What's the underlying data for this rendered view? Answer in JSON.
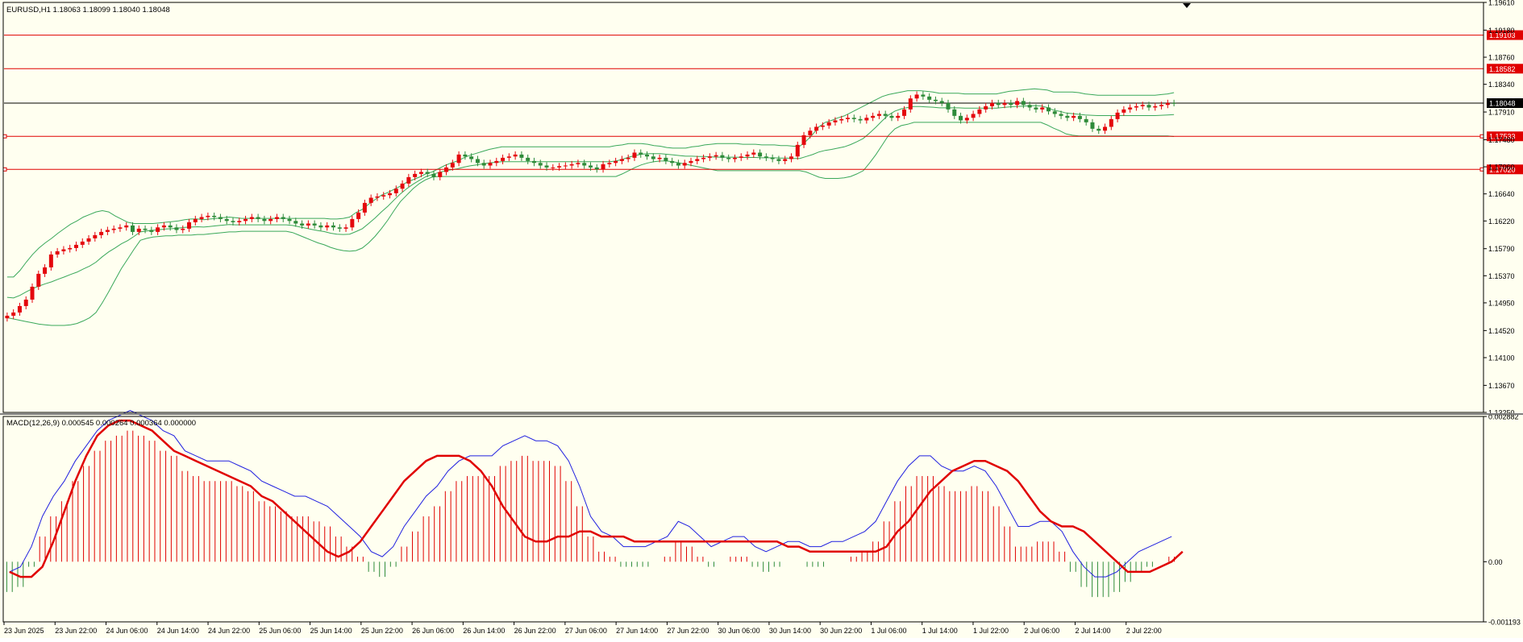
{
  "window": {
    "symbol_header": "EURUSD,H1  1.18063 1.18099 1.18040 1.18048",
    "macd_header": "MACD(12,26,9) 0.000545 0.000264 0.000364 0.000000"
  },
  "colors": {
    "background": "#fffff0",
    "frame": "#000000",
    "bull_candle": "#e4070d",
    "bear_candle": "#2e8b3a",
    "bands": "#3aa85a",
    "level_line": "#e00000",
    "price_line": "#000000",
    "macd_line": "#2020e0",
    "signal_line": "#e00000",
    "hist_positive": "#e00000",
    "hist_negative": "#2e8b3a"
  },
  "chart_data": [
    {
      "type": "candlestick",
      "symbol": "EURUSD",
      "timeframe": "H1",
      "ohlc_header": {
        "open": 1.18063,
        "high": 1.18099,
        "low": 1.1804,
        "close": 1.18048
      },
      "ylim": [
        1.1325,
        1.1961
      ],
      "y_ticks": [
        "1.19610",
        "1.19180",
        "1.18760",
        "1.18340",
        "1.17910",
        "1.17480",
        "1.17060",
        "1.16640",
        "1.16220",
        "1.15790",
        "1.15370",
        "1.14950",
        "1.14520",
        "1.14100",
        "1.13670",
        "1.13250"
      ],
      "x_ticks": [
        "23 Jun 2025",
        "23 Jun 22:00",
        "24 Jun 06:00",
        "24 Jun 14:00",
        "24 Jun 22:00",
        "25 Jun 06:00",
        "25 Jun 14:00",
        "25 Jun 22:00",
        "26 Jun 06:00",
        "26 Jun 14:00",
        "26 Jun 22:00",
        "27 Jun 06:00",
        "27 Jun 14:00",
        "27 Jun 22:00",
        "30 Jun 06:00",
        "30 Jun 14:00",
        "30 Jun 22:00",
        "1 Jul 06:00",
        "1 Jul 14:00",
        "1 Jul 22:00",
        "2 Jul 06:00",
        "2 Jul 14:00",
        "2 Jul 22:00"
      ],
      "horizontal_levels": [
        {
          "label": "1.19103",
          "value": 1.19103,
          "kind": "resistance"
        },
        {
          "label": "1.18582",
          "value": 1.18582,
          "kind": "resistance"
        },
        {
          "label": "1.18048",
          "value": 1.18048,
          "kind": "current_price"
        },
        {
          "label": "1.17533",
          "value": 1.17533,
          "kind": "support"
        },
        {
          "label": "1.17020",
          "value": 1.1702,
          "kind": "support"
        }
      ],
      "close_path": [
        1.1475,
        1.148,
        1.149,
        1.15,
        1.152,
        1.154,
        1.155,
        1.157,
        1.1575,
        1.1578,
        1.158,
        1.1585,
        1.159,
        1.1595,
        1.16,
        1.1605,
        1.1608,
        1.161,
        1.1612,
        1.1615,
        1.1605,
        1.161,
        1.1608,
        1.1605,
        1.1612,
        1.1615,
        1.1612,
        1.1608,
        1.161,
        1.162,
        1.1625,
        1.1628,
        1.163,
        1.1628,
        1.1625,
        1.1622,
        1.162,
        1.1622,
        1.1625,
        1.1628,
        1.1625,
        1.1622,
        1.1625,
        1.1628,
        1.1625,
        1.1622,
        1.1618,
        1.1615,
        1.1618,
        1.1615,
        1.1612,
        1.1615,
        1.1612,
        1.161,
        1.1612,
        1.1625,
        1.1635,
        1.165,
        1.1658,
        1.166,
        1.1662,
        1.1665,
        1.1672,
        1.168,
        1.169,
        1.1695,
        1.1698,
        1.1695,
        1.169,
        1.1698,
        1.1705,
        1.1712,
        1.1725,
        1.1722,
        1.1718,
        1.1712,
        1.1708,
        1.1712,
        1.1715,
        1.172,
        1.1722,
        1.1725,
        1.172,
        1.1715,
        1.1712,
        1.1708,
        1.1705,
        1.1705,
        1.1707,
        1.1708,
        1.171,
        1.1712,
        1.1708,
        1.1705,
        1.1702,
        1.171,
        1.1712,
        1.1715,
        1.1718,
        1.172,
        1.1728,
        1.1725,
        1.1722,
        1.1718,
        1.172,
        1.1715,
        1.1712,
        1.1708,
        1.1712,
        1.1715,
        1.1718,
        1.172,
        1.1722,
        1.1724,
        1.172,
        1.1718,
        1.172,
        1.1722,
        1.1725,
        1.1728,
        1.1722,
        1.172,
        1.1718,
        1.1715,
        1.1718,
        1.1722,
        1.174,
        1.1755,
        1.1762,
        1.1768,
        1.177,
        1.1775,
        1.1778,
        1.178,
        1.1782,
        1.178,
        1.1778,
        1.1782,
        1.1785,
        1.1788,
        1.1785,
        1.1782,
        1.1785,
        1.1795,
        1.1812,
        1.1818,
        1.1815,
        1.181,
        1.1808,
        1.1805,
        1.1795,
        1.1785,
        1.1778,
        1.1782,
        1.1788,
        1.1795,
        1.18,
        1.1805,
        1.1802,
        1.1805,
        1.1802,
        1.1808,
        1.1802,
        1.1798,
        1.1795,
        1.1798,
        1.1792,
        1.1788,
        1.1785,
        1.1782,
        1.1785,
        1.178,
        1.1775,
        1.1765,
        1.1762,
        1.1768,
        1.178,
        1.179,
        1.1795,
        1.1798,
        1.18,
        1.1802,
        1.1798,
        1.18,
        1.1802,
        1.1805,
        1.18048
      ],
      "band_top": [
        1.1535,
        1.1535,
        1.1545,
        1.1558,
        1.157,
        1.158,
        1.1588,
        1.1595,
        1.1603,
        1.161,
        1.1617,
        1.1622,
        1.1628,
        1.1632,
        1.1636,
        1.1638,
        1.1636,
        1.163,
        1.1625,
        1.162,
        1.1618,
        1.1618,
        1.1618,
        1.1618,
        1.1619,
        1.162,
        1.1621,
        1.1622,
        1.1624,
        1.1625,
        1.1625,
        1.1624,
        1.1625,
        1.1626,
        1.1627,
        1.1628,
        1.1627,
        1.1626,
        1.1626,
        1.1626,
        1.1626,
        1.1626,
        1.1626,
        1.1626,
        1.1626,
        1.1626,
        1.1626,
        1.1626,
        1.1626,
        1.1626,
        1.1626,
        1.1625,
        1.1625,
        1.1626,
        1.1628,
        1.1635,
        1.164,
        1.1648,
        1.1655,
        1.1662,
        1.1666,
        1.1671,
        1.1676,
        1.1682,
        1.1686,
        1.169,
        1.1695,
        1.1698,
        1.1703,
        1.1708,
        1.1712,
        1.1715,
        1.172,
        1.1724,
        1.1727,
        1.173,
        1.1733,
        1.1735,
        1.1737,
        1.1737,
        1.1737,
        1.1737,
        1.1737,
        1.1737,
        1.1737,
        1.1737,
        1.1737,
        1.1737,
        1.1737,
        1.1737,
        1.1737,
        1.1737,
        1.1737,
        1.1737,
        1.1737,
        1.1737,
        1.1739,
        1.174,
        1.1742,
        1.1742,
        1.1742,
        1.1741,
        1.1739,
        1.1738,
        1.1736,
        1.1735,
        1.1735,
        1.1735,
        1.1737,
        1.1738,
        1.174,
        1.1741,
        1.1742,
        1.1742,
        1.1742,
        1.1742,
        1.1741,
        1.1741,
        1.1741,
        1.174,
        1.174,
        1.174,
        1.1739,
        1.1739,
        1.1738,
        1.1738,
        1.1746,
        1.1756,
        1.1768,
        1.1775,
        1.1778,
        1.1782,
        1.1785,
        1.179,
        1.1795,
        1.18,
        1.1805,
        1.181,
        1.1815,
        1.1818,
        1.182,
        1.1822,
        1.1824,
        1.1824,
        1.1824,
        1.1823,
        1.1822,
        1.182,
        1.182,
        1.182,
        1.182,
        1.1819,
        1.1819,
        1.1819,
        1.1819,
        1.1819,
        1.1819,
        1.1821,
        1.1823,
        1.1824,
        1.1825,
        1.1826,
        1.1827,
        1.1826,
        1.1825,
        1.1822,
        1.1822,
        1.1822,
        1.1822,
        1.1821,
        1.1819,
        1.1818,
        1.1817,
        1.1817,
        1.1817,
        1.1817,
        1.1817,
        1.1817,
        1.1817,
        1.1817,
        1.1817,
        1.1817,
        1.1818,
        1.1819,
        1.1821
      ],
      "band_bottom": [
        1.1472,
        1.147,
        1.1468,
        1.1466,
        1.1464,
        1.1462,
        1.1461,
        1.146,
        1.146,
        1.146,
        1.1461,
        1.1463,
        1.1467,
        1.1472,
        1.148,
        1.1495,
        1.1512,
        1.153,
        1.1548,
        1.1563,
        1.1578,
        1.1592,
        1.1595,
        1.1597,
        1.1598,
        1.1599,
        1.1599,
        1.16,
        1.16,
        1.16,
        1.1601,
        1.1601,
        1.1602,
        1.1603,
        1.1604,
        1.1605,
        1.1605,
        1.1606,
        1.1606,
        1.1606,
        1.1606,
        1.1606,
        1.1606,
        1.1606,
        1.1606,
        1.1604,
        1.16,
        1.1596,
        1.1592,
        1.1588,
        1.1585,
        1.1581,
        1.1578,
        1.1576,
        1.1575,
        1.1576,
        1.158,
        1.1588,
        1.1598,
        1.161,
        1.1623,
        1.1638,
        1.1652,
        1.1662,
        1.1672,
        1.168,
        1.1686,
        1.169,
        1.1691,
        1.1691,
        1.1691,
        1.1691,
        1.1691,
        1.1691,
        1.1691,
        1.1691,
        1.1691,
        1.1691,
        1.1691,
        1.1691,
        1.1691,
        1.1691,
        1.1691,
        1.1691,
        1.1691,
        1.1691,
        1.1691,
        1.1691,
        1.1691,
        1.1691,
        1.1691,
        1.1691,
        1.1691,
        1.1691,
        1.1691,
        1.1691,
        1.1691,
        1.1695,
        1.17,
        1.1705,
        1.1709,
        1.1712,
        1.1714,
        1.1715,
        1.1715,
        1.1714,
        1.1712,
        1.171,
        1.1708,
        1.1706,
        1.1704,
        1.1702,
        1.17,
        1.17,
        1.17,
        1.17,
        1.17,
        1.17,
        1.17,
        1.17,
        1.17,
        1.17,
        1.17,
        1.17,
        1.17,
        1.17,
        1.1698,
        1.1694,
        1.169,
        1.1688,
        1.1688,
        1.1688,
        1.1689,
        1.1691,
        1.1695,
        1.17,
        1.1712,
        1.1725,
        1.174,
        1.1755,
        1.1765,
        1.177,
        1.1772,
        1.1775,
        1.1775,
        1.1775,
        1.1775,
        1.1775,
        1.1775,
        1.1775,
        1.1775,
        1.1775,
        1.1775,
        1.1775,
        1.1775,
        1.1775,
        1.1775,
        1.1775,
        1.1775,
        1.1775,
        1.1775,
        1.1775,
        1.1775,
        1.1775,
        1.1771,
        1.1766,
        1.1762,
        1.1757,
        1.1755,
        1.1754,
        1.1754,
        1.1754,
        1.1754,
        1.1754,
        1.1754,
        1.1754,
        1.1754,
        1.1754,
        1.1754,
        1.1754,
        1.1754,
        1.1754,
        1.1754,
        1.1754,
        1.1753
      ]
    },
    {
      "type": "macd",
      "title": "MACD(12,26,9)",
      "values_header": [
        0.000545,
        0.000264,
        0.000364,
        0.0
      ],
      "ylim": [
        -0.001193,
        0.002882
      ],
      "y_ticks": [
        "0.002882",
        "0.00",
        "-0.001193"
      ],
      "macd_path": [
        -0.0002,
        -0.0001,
        0.0003,
        0.0009,
        0.0013,
        0.0016,
        0.002,
        0.0023,
        0.0026,
        0.0028,
        0.0029,
        0.003,
        0.0029,
        0.0028,
        0.0026,
        0.0025,
        0.0022,
        0.0021,
        0.002,
        0.002,
        0.002,
        0.0019,
        0.0018,
        0.0016,
        0.0015,
        0.0014,
        0.0013,
        0.0013,
        0.0012,
        0.0011,
        0.0009,
        0.0007,
        0.0005,
        0.0002,
        0.0001,
        0.0003,
        0.0007,
        0.001,
        0.0013,
        0.0015,
        0.0018,
        0.002,
        0.0021,
        0.0021,
        0.0021,
        0.0023,
        0.0024,
        0.0025,
        0.0024,
        0.0024,
        0.0023,
        0.002,
        0.0015,
        0.0009,
        0.0006,
        0.0005,
        0.0003,
        0.0003,
        0.0003,
        0.0004,
        0.0005,
        0.0008,
        0.0007,
        0.0005,
        0.0003,
        0.0004,
        0.0005,
        0.0005,
        0.0003,
        0.0002,
        0.0003,
        0.0004,
        0.0004,
        0.0003,
        0.0003,
        0.0004,
        0.0004,
        0.0005,
        0.0006,
        0.0008,
        0.0012,
        0.0016,
        0.0019,
        0.0021,
        0.0021,
        0.0019,
        0.0018,
        0.0018,
        0.0019,
        0.0018,
        0.0015,
        0.0011,
        0.0007,
        0.0007,
        0.0008,
        0.0008,
        0.0006,
        0.0002,
        -0.0001,
        -0.0003,
        -0.0003,
        -0.0002,
        0.0,
        0.0002,
        0.0003,
        0.0004,
        0.0005
      ],
      "signal_path": [
        -0.0002,
        -0.0003,
        -0.0003,
        -0.0001,
        0.0004,
        0.001,
        0.0016,
        0.0021,
        0.0025,
        0.0027,
        0.0028,
        0.0028,
        0.0027,
        0.0026,
        0.0024,
        0.0022,
        0.0021,
        0.002,
        0.0019,
        0.0018,
        0.0017,
        0.0016,
        0.0015,
        0.0013,
        0.0012,
        0.001,
        0.0008,
        0.0006,
        0.0004,
        0.0002,
        0.0001,
        0.0002,
        0.0004,
        0.0007,
        0.001,
        0.0013,
        0.0016,
        0.0018,
        0.002,
        0.0021,
        0.0021,
        0.0021,
        0.002,
        0.0018,
        0.0015,
        0.0011,
        0.0008,
        0.0005,
        0.0004,
        0.0004,
        0.0005,
        0.0005,
        0.0006,
        0.0006,
        0.0005,
        0.0005,
        0.0005,
        0.0004,
        0.0004,
        0.0004,
        0.0004,
        0.0004,
        0.0004,
        0.0004,
        0.0004,
        0.0004,
        0.0004,
        0.0004,
        0.0004,
        0.0004,
        0.0004,
        0.0003,
        0.0003,
        0.0002,
        0.0002,
        0.0002,
        0.0002,
        0.0002,
        0.0002,
        0.0002,
        0.0003,
        0.0006,
        0.0008,
        0.0011,
        0.0014,
        0.0016,
        0.0018,
        0.0019,
        0.002,
        0.002,
        0.0019,
        0.0018,
        0.0016,
        0.0013,
        0.001,
        0.0008,
        0.0007,
        0.0007,
        0.0006,
        0.0004,
        0.0002,
        0.0,
        -0.0002,
        -0.0002,
        -0.0002,
        -0.0001,
        0.0,
        0.0002
      ]
    }
  ]
}
